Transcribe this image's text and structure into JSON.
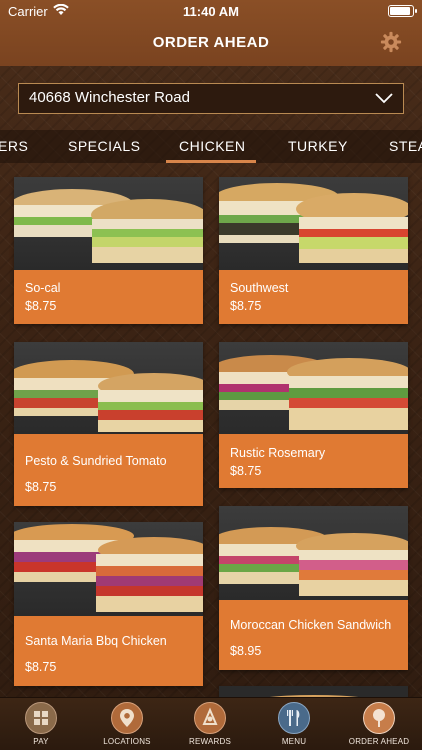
{
  "status_bar": {
    "carrier": "Carrier",
    "time": "11:40 AM",
    "battery_level": 1.0
  },
  "header": {
    "title": "ORDER AHEAD",
    "settings_icon": "gear-icon"
  },
  "location": {
    "selected": "40668 Winchester Road",
    "icon": "chevron-down-icon"
  },
  "tabs": [
    {
      "label": "ERS"
    },
    {
      "label": "SPECIALS"
    },
    {
      "label": "CHICKEN",
      "active": true
    },
    {
      "label": "TURKEY"
    },
    {
      "label": "STEA"
    }
  ],
  "items": [
    {
      "name": "So-cal",
      "price": "$8.75"
    },
    {
      "name": "Southwest",
      "price": "$8.75"
    },
    {
      "name": "Pesto & Sundried Tomato",
      "price": "$8.75"
    },
    {
      "name": "Rustic Rosemary",
      "price": "$8.75"
    },
    {
      "name": "Santa Maria Bbq Chicken",
      "price": "$8.75"
    },
    {
      "name": "Moroccan Chicken Sandwich",
      "price": "$8.95"
    }
  ],
  "tab_bar": [
    {
      "label": "PAY",
      "icon": "pay-icon"
    },
    {
      "label": "LOCATIONS",
      "icon": "location-pin-icon"
    },
    {
      "label": "REWARDS",
      "icon": "rewards-icon"
    },
    {
      "label": "MENU",
      "icon": "fork-knife-icon"
    },
    {
      "label": "ORDER AHEAD",
      "icon": "order-ahead-icon",
      "active": true
    }
  ],
  "colors": {
    "header": "#7a4320",
    "card": "#e07a33",
    "accent": "#d8854a"
  }
}
